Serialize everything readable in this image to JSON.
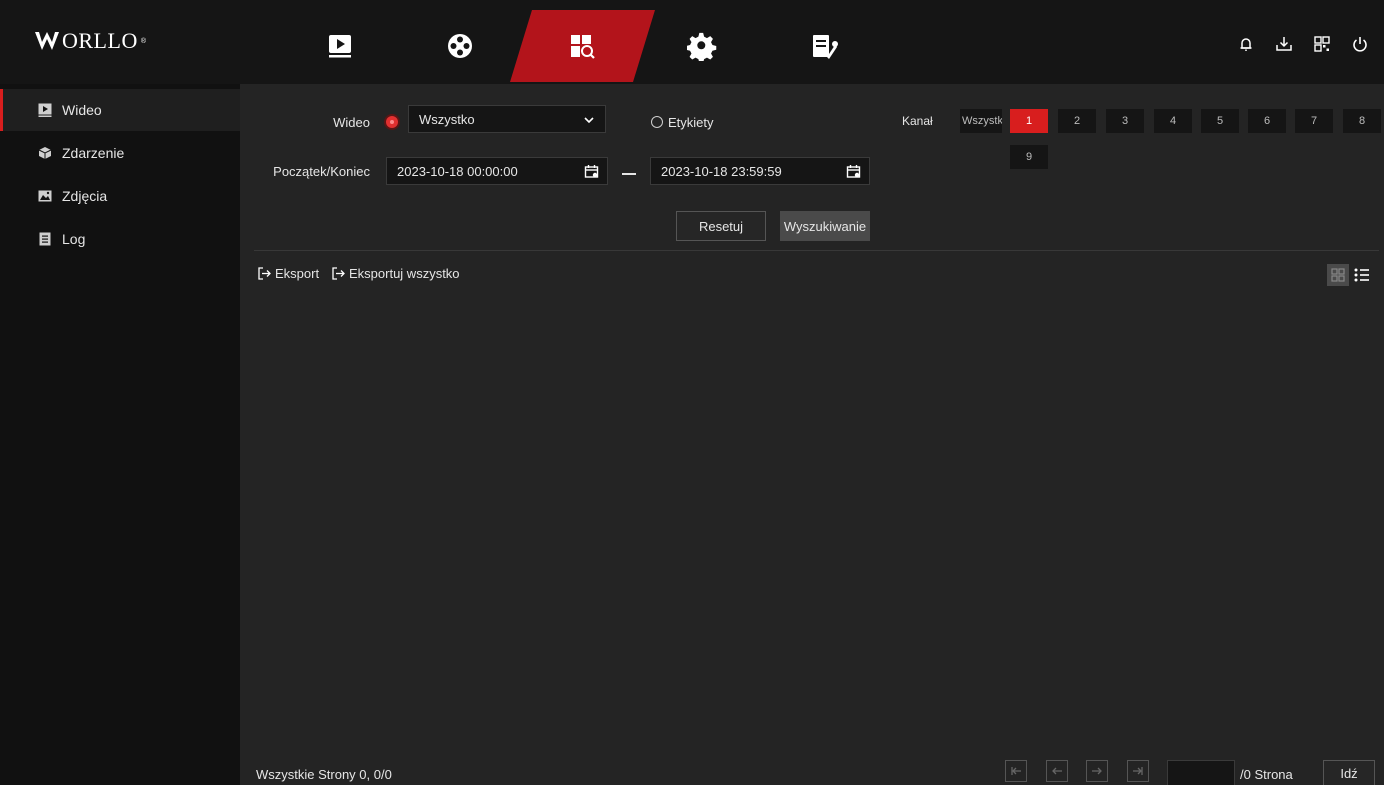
{
  "brand": {
    "logo_text": "ORLLO",
    "logo_reg": "®",
    "accent": "#d81e1e"
  },
  "topnav": {
    "tabs": [
      {
        "name": "playback",
        "icon": "play-icon",
        "active": false
      },
      {
        "name": "events",
        "icon": "film-reel-icon",
        "active": false
      },
      {
        "name": "search",
        "icon": "file-search-icon",
        "active": true
      },
      {
        "name": "settings",
        "icon": "gear-icon",
        "active": false
      },
      {
        "name": "maintenance",
        "icon": "doc-wrench-icon",
        "active": false
      }
    ],
    "right_icons": [
      "bell-icon",
      "download-icon",
      "qr-code-icon",
      "power-icon"
    ]
  },
  "sidebar": {
    "items": [
      {
        "label": "Wideo",
        "icon": "video-icon",
        "active": true
      },
      {
        "label": "Zdarzenie",
        "icon": "box-icon",
        "active": false
      },
      {
        "label": "Zdjęcia",
        "icon": "image-icon",
        "active": false
      },
      {
        "label": "Log",
        "icon": "log-icon",
        "active": false
      }
    ]
  },
  "search": {
    "video_label": "Wideo",
    "video_type_value": "Wszystko",
    "tags_label": "Etykiety",
    "range_label": "Początek/Koniec",
    "start": "2023-10-18 00:00:00",
    "end": "2023-10-18 23:59:59",
    "channel_label": "Kanał",
    "channel_all": "Wszystko",
    "channels": [
      "1",
      "2",
      "3",
      "4",
      "5",
      "6",
      "7",
      "8",
      "9"
    ],
    "active_channel": "1",
    "reset_label": "Resetuj",
    "search_label": "Wyszukiwanie"
  },
  "toolbar": {
    "export_label": "Eksport",
    "export_all_label": "Eksportuj wszystko"
  },
  "pagination": {
    "summary": "Wszystkie Strony 0, 0/0",
    "page_suffix": "/0 Strona",
    "go_label": "Idź"
  }
}
